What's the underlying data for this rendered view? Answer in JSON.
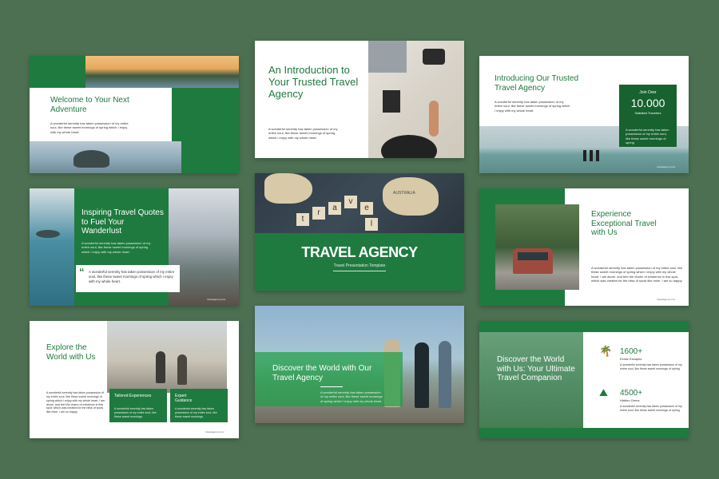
{
  "slides": {
    "s1": {
      "title": "Welcome to Your Next Adventure",
      "body": "A wonderful serenity has taken possession of my entire soul, like these sweet mornings of spring which I enjoy with my whole heart."
    },
    "s2": {
      "title": "An Introduction to Your Trusted Travel Agency",
      "body": "A wonderful serenity has taken possession of my entire soul, like these sweet mornings of spring which I enjoy with my whole heart."
    },
    "s3": {
      "title": "Introducing Our Trusted Travel Agency",
      "body": "A wonderful serenity has taken possession of my entire soul, like these sweet mornings of spring which I enjoy with my whole heart.",
      "join_label": "Join Over",
      "stat_value": "10.000",
      "stat_label": "Satisfied Travelers",
      "stat_body": "A wonderful serenity has taken possession of my entire soul, like these sweet mornings of spring",
      "footer": "travelagency.com"
    },
    "s4": {
      "title": "Inspiring Travel Quotes to Fuel Your Wanderlust",
      "body": "A wonderful serenity has taken possession of my entire soul, like these sweet mornings of spring which I enjoy with my whole heart.",
      "quote": "A wonderful serenity has taken possession of my entire soul, like these sweet mornings of spring which I enjoy with my whole heart.",
      "footer": "travelagency.com"
    },
    "s5": {
      "title": "TRAVEL AGENCY",
      "subtitle": "Travel Presentation Template",
      "tile_1": "t",
      "tile_2": "r",
      "tile_3": "a",
      "tile_4": "v",
      "tile_5": "e",
      "tile_6": "l",
      "map_label": "AUSTRALIA"
    },
    "s6": {
      "title": "Experience Exceptional Travel with Us",
      "body": "A wonderful serenity has taken possession of my entire soul, like these sweet mornings of spring which I enjoy with my whole heart. I am alone, and feel the charm of existence in this spot, which was created for the bliss of souls like mine. I am so happy.",
      "footer": "travelagency.com"
    },
    "s7": {
      "title": "Explore the World with Us",
      "body": "A wonderful serenity has taken possession of my entire soul, like these sweet mornings of spring which I enjoy with my whole heart. I am alone, and feel the charm of existence in this spot, which was created for the bliss of souls like mine. I am so happy.",
      "card1_title": "Tailored Experiences",
      "card1_body": "A wonderful serenity has taken possession of my entire soul, like these sweet mornings.",
      "card2_title": "Expert Guidance",
      "card2_body": "A wonderful serenity has taken possession of my entire soul, like these sweet mornings.",
      "footer": "travelagency.com"
    },
    "s8": {
      "title": "Discover the World with Our Travel Agency",
      "body": "A wonderful serenity has taken possession of my entire soul, like these sweet mornings of spring which I enjoy with my whole heart."
    },
    "s9": {
      "title": "Discover the World with Us: Your Ultimate Travel Companion",
      "stat1_value": "1600+",
      "stat1_label": "Exotic Escapes",
      "stat1_body": "A wonderful serenity has taken possession of my entire soul, like these sweet mornings of spring",
      "stat2_value": "4500+",
      "stat2_label": "Hidden Gems",
      "stat2_body": "A wonderful serenity has taken possession of my entire soul, like these sweet mornings of spring"
    }
  },
  "colors": {
    "background": "#4d7052",
    "brand_green": "#1f7a3f",
    "white": "#ffffff"
  },
  "icons": {
    "quote": "quote-icon",
    "palm": "palm-tree-icon",
    "mountain": "mountain-icon"
  }
}
